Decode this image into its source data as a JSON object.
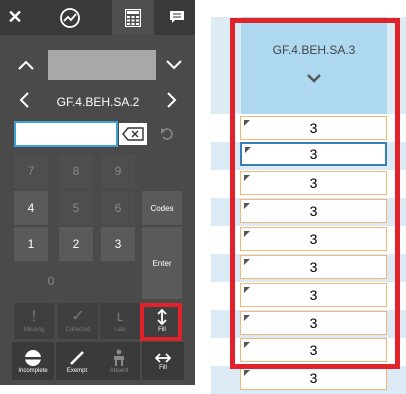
{
  "keypad": {
    "close_glyph": "✕",
    "student_label": "GF.4.BEH.SA.2",
    "keys": {
      "k7": "7",
      "k8": "8",
      "k9": "9",
      "k4": "4",
      "k5": "5",
      "k6": "6",
      "k1": "1",
      "k2": "2",
      "k3": "3",
      "k0": "0",
      "codes": "Codes",
      "enter": "Enter"
    },
    "actions": {
      "missing": "Missing",
      "collected": "Collected",
      "late": "Late",
      "fill": "Fill"
    },
    "bottom": {
      "incomplete": "Incomplete",
      "exempt": "Exempt",
      "absent": "Absent",
      "fill": "Fill"
    }
  },
  "grid": {
    "column_header": "GF.4.BEH.SA.3",
    "cells": [
      "3",
      "3",
      "3",
      "3",
      "3",
      "3",
      "3",
      "3",
      "3",
      "3"
    ],
    "selected_row": 1
  },
  "colors": {
    "highlight_red": "#e1222a",
    "header_blue": "#add8ef",
    "cell_border_orange": "#f0b878",
    "selection_blue": "#3a7fb8",
    "panel_dark": "#4a4a4a"
  }
}
